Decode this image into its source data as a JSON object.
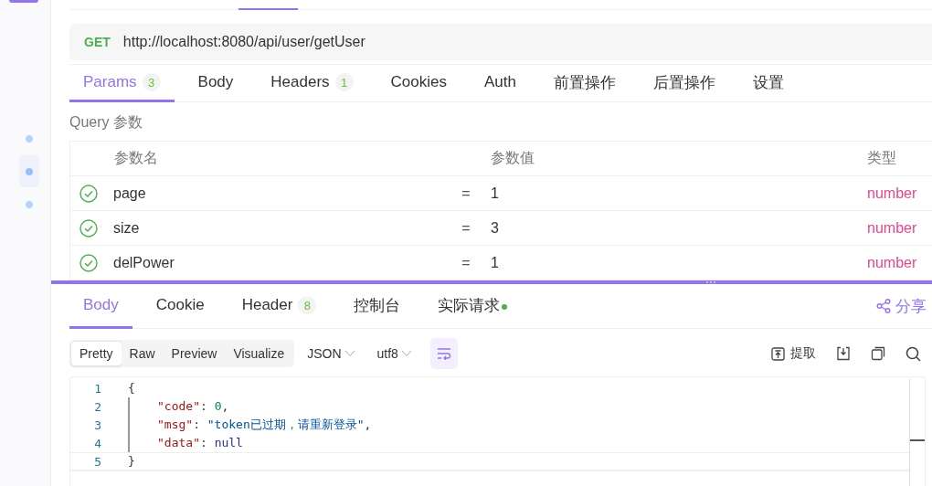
{
  "sidebar": {
    "items": [
      {
        "selected": false
      },
      {
        "selected": true
      },
      {
        "selected": false
      }
    ]
  },
  "request": {
    "method": "GET",
    "url": "http://localhost:8080/api/user/getUser"
  },
  "request_tabs": [
    {
      "label": "Params",
      "count": "3",
      "selected": true
    },
    {
      "label": "Body",
      "selected": false
    },
    {
      "label": "Headers",
      "count": "1",
      "selected": false
    },
    {
      "label": "Cookies",
      "selected": false
    },
    {
      "label": "Auth",
      "selected": false
    },
    {
      "label": "前置操作",
      "selected": false
    },
    {
      "label": "后置操作",
      "selected": false
    },
    {
      "label": "设置",
      "selected": false
    }
  ],
  "query_title": "Query 参数",
  "params_table": {
    "columns": [
      "参数名",
      "参数值",
      "类型"
    ],
    "rows": [
      {
        "enabled": true,
        "name": "page",
        "operator": "=",
        "value": "1",
        "type": "number"
      },
      {
        "enabled": true,
        "name": "size",
        "operator": "=",
        "value": "3",
        "type": "number"
      },
      {
        "enabled": true,
        "name": "delPower",
        "operator": "=",
        "value": "1",
        "type": "number"
      }
    ]
  },
  "response_tabs": [
    {
      "label": "Body",
      "selected": true
    },
    {
      "label": "Cookie",
      "selected": false
    },
    {
      "label": "Header",
      "count": "8",
      "selected": false
    },
    {
      "label": "控制台",
      "selected": false
    },
    {
      "label": "实际请求",
      "selected": false,
      "indicator": true
    }
  ],
  "share": "分享",
  "view_modes": [
    {
      "label": "Pretty",
      "selected": true
    },
    {
      "label": "Raw",
      "selected": false
    },
    {
      "label": "Preview",
      "selected": false
    },
    {
      "label": "Visualize",
      "selected": false
    }
  ],
  "format": "JSON",
  "encoding": "utf8",
  "wrap": {
    "on": true
  },
  "extract": "提取",
  "code_lines": [
    {
      "number": "1",
      "indented": false,
      "active": false,
      "tokens": [
        {
          "kind": "punct",
          "text": "{"
        }
      ]
    },
    {
      "number": "2",
      "indented": true,
      "active": false,
      "tokens": [
        {
          "kind": "key",
          "text": "\"code\""
        },
        {
          "kind": "punct",
          "text": ": "
        },
        {
          "kind": "number",
          "text": "0"
        },
        {
          "kind": "punct",
          "text": ","
        }
      ]
    },
    {
      "number": "3",
      "indented": true,
      "active": false,
      "tokens": [
        {
          "kind": "key",
          "text": "\"msg\""
        },
        {
          "kind": "punct",
          "text": ": "
        },
        {
          "kind": "string",
          "text": "\"token已过期，请重新登录\""
        },
        {
          "kind": "punct",
          "text": ","
        }
      ]
    },
    {
      "number": "4",
      "indented": true,
      "active": false,
      "tokens": [
        {
          "kind": "key",
          "text": "\"data\""
        },
        {
          "kind": "punct",
          "text": ": "
        },
        {
          "kind": "keyword",
          "text": "null"
        }
      ]
    },
    {
      "number": "5",
      "indented": false,
      "active": true,
      "tokens": [
        {
          "kind": "punct",
          "text": "}"
        }
      ]
    }
  ]
}
